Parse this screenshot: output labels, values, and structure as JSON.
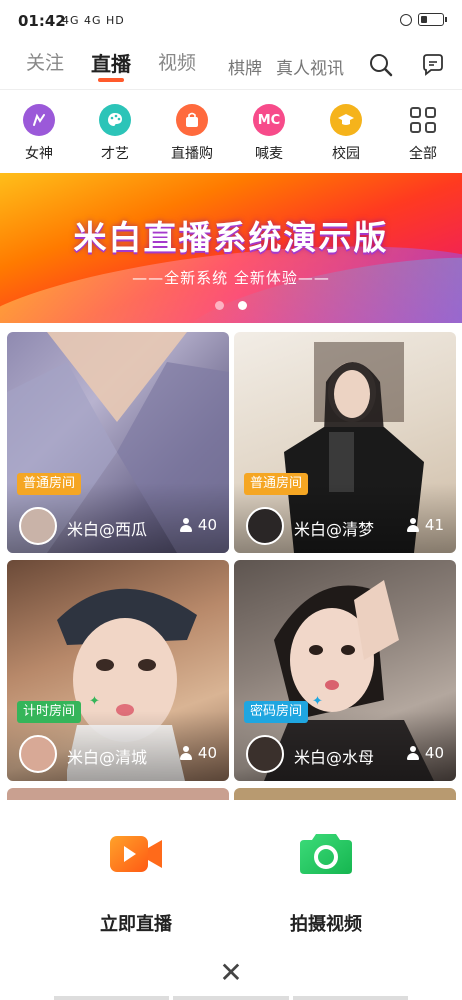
{
  "status": {
    "time": "01:42",
    "signal_text": "4G 4G HD"
  },
  "nav": {
    "tabs": [
      "关注",
      "直播",
      "视频"
    ],
    "extra": [
      "棋牌",
      "真人视讯"
    ],
    "active": "直播"
  },
  "categories": [
    {
      "label": "女神",
      "icon": "goddess-icon",
      "color": "#9b59d9"
    },
    {
      "label": "才艺",
      "icon": "talent-palette-icon",
      "color": "#2cc4b8"
    },
    {
      "label": "直播购",
      "icon": "shopping-bag-icon",
      "color": "#ff6a3d"
    },
    {
      "label": "喊麦",
      "icon": "mc-icon",
      "icon_text": "MC",
      "color": "#f74b8a"
    },
    {
      "label": "校园",
      "icon": "graduation-cap-icon",
      "color": "#f5b31b"
    },
    {
      "label": "全部",
      "icon": "grid-icon",
      "color": "#444444"
    }
  ],
  "banner": {
    "title": "米白直播系统演示版",
    "subtitle": "——全新系统 全新体验——",
    "page_index": 1,
    "page_count": 2
  },
  "rooms": [
    {
      "tag": "普通房间",
      "tag_color": "#f5a623",
      "host": "米白@西瓜",
      "viewers": "40"
    },
    {
      "tag": "普通房间",
      "tag_color": "#f5a623",
      "host": "米白@清梦",
      "viewers": "41"
    },
    {
      "tag": "计时房间",
      "tag_color": "#35b55a",
      "host": "米白@清城",
      "viewers": "40"
    },
    {
      "tag": "密码房间",
      "tag_color": "#1fa6e0",
      "host": "米白@水母",
      "viewers": "40"
    }
  ],
  "sheet": {
    "live_label": "立即直播",
    "video_label": "拍摄视频",
    "live_color": "#ff6a1a",
    "video_color": "#1fc45a"
  }
}
